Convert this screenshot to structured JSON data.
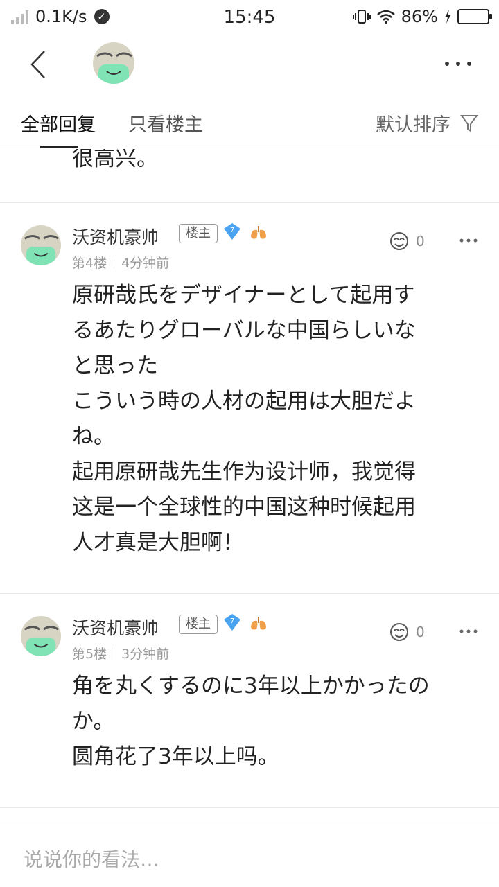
{
  "status_bar": {
    "net_speed": "0.1K/s",
    "time": "15:45",
    "battery_pct": "86%",
    "battery_level": 0.86
  },
  "nav": {
    "back_icon": "chevron-left-icon",
    "more_icon": "more-horizontal-icon"
  },
  "tabs": {
    "all_replies": "全部回复",
    "op_only": "只看楼主",
    "sort_label": "默认排序",
    "filter_icon": "filter-icon"
  },
  "thread": {
    "partial_text": "很高兴。",
    "posts": [
      {
        "username": "沃资机豪帅",
        "op_badge": "楼主",
        "level": "7",
        "floor": "第4楼",
        "time": "4分钟前",
        "likes": "0",
        "content": "原研哉氏をデザイナーとして起用す\nるあたりグローバルな中国らしいな\nと思った\nこういう時の人材の起用は大胆だよ\nね。\n起用原研哉先生作为设计师，我觉得\n这是一个全球性的中国这种时候起用\n人才真是大胆啊！"
      },
      {
        "username": "沃资机豪帅",
        "op_badge": "楼主",
        "level": "7",
        "floor": "第5楼",
        "time": "3分钟前",
        "likes": "0",
        "content": "角を丸くするのに3年以上かかったの\nか。\n圆角花了3年以上吗。"
      }
    ]
  },
  "comment_bar": {
    "placeholder": "说说你的看法…"
  },
  "colors": {
    "level_badge": "#4aa3f0",
    "lungs_icon": "#f0a04a",
    "avatar_mask": "#7fe3b5"
  }
}
